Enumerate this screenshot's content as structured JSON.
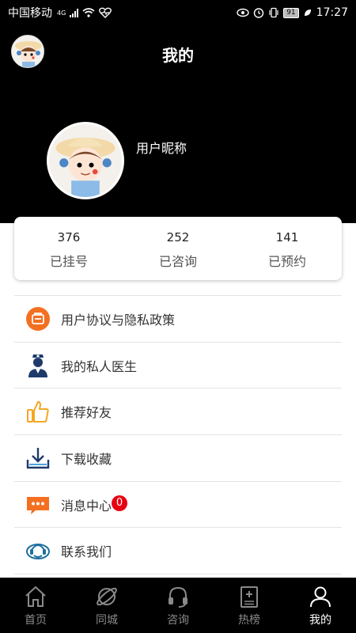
{
  "status_bar": {
    "carrier": "中国移动",
    "network": "4G",
    "battery": "91",
    "time": "17:27"
  },
  "header": {
    "title": "我的",
    "nickname": "用户昵称"
  },
  "stats": [
    {
      "value": "376",
      "label": "已挂号"
    },
    {
      "value": "252",
      "label": "已咨询"
    },
    {
      "value": "141",
      "label": "已预约"
    }
  ],
  "menu": {
    "items": [
      {
        "label": "用户协议与隐私政策",
        "icon": "document-icon"
      },
      {
        "label": "我的私人医生",
        "icon": "doctor-icon"
      },
      {
        "label": "推荐好友",
        "icon": "thumbs-up-icon"
      },
      {
        "label": "下载收藏",
        "icon": "download-icon"
      },
      {
        "label": "消息中心",
        "icon": "message-icon",
        "badge": "0"
      },
      {
        "label": "联系我们",
        "icon": "headset-icon"
      }
    ]
  },
  "tabs": [
    {
      "label": "首页",
      "icon": "home-icon"
    },
    {
      "label": "同城",
      "icon": "planet-icon"
    },
    {
      "label": "咨询",
      "icon": "headphones-icon"
    },
    {
      "label": "热榜",
      "icon": "ranking-icon"
    },
    {
      "label": "我的",
      "icon": "user-icon",
      "active": true
    }
  ],
  "colors": {
    "header_bg": "#000000",
    "badge": "#e60012",
    "orange": "#f37021",
    "navy": "#1e3a6b",
    "active_tab": "#ffffff",
    "inactive_tab": "#8a8a8a"
  }
}
